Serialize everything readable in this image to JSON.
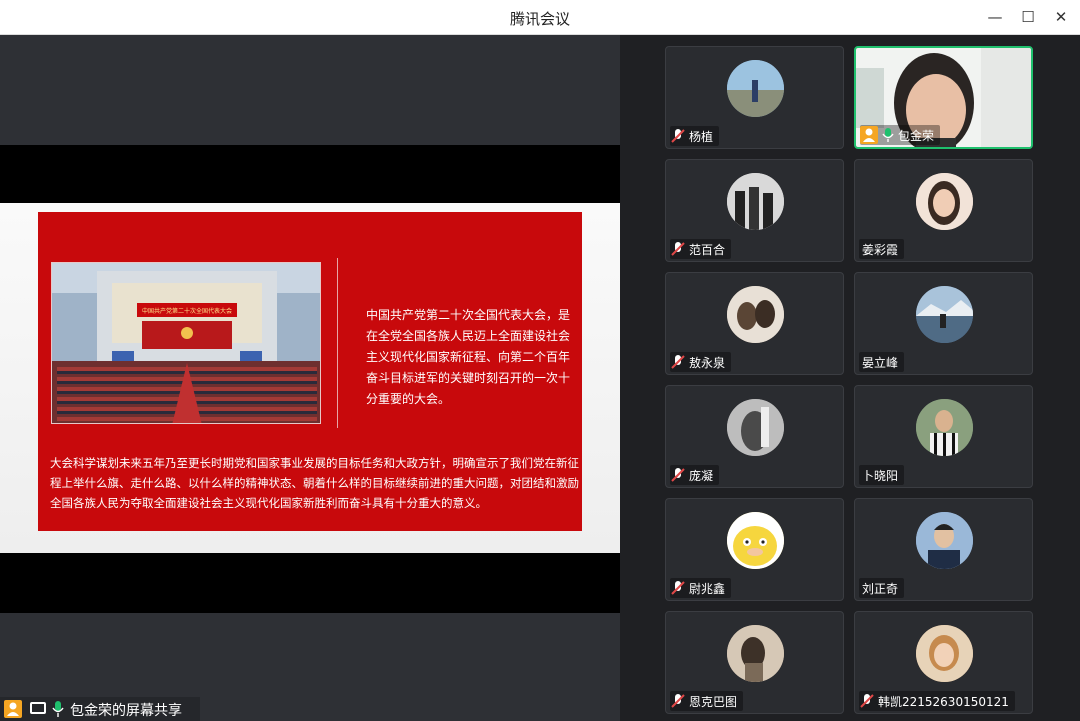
{
  "window": {
    "title": "腾讯会议",
    "minimize": "—",
    "maximize": "☐",
    "close": "✕"
  },
  "slide": {
    "right_text": "中国共产党第二十次全国代表大会，是在全党全国各族人民迈上全面建设社会主义现代化国家新征程、向第二个百年奋斗目标进军的关键时刻召开的一次十分重要的大会。",
    "bottom_text": "大会科学谋划未来五年乃至更长时期党和国家事业发展的目标任务和大政方针，明确宣示了我们党在新征程上举什么旗、走什么路、以什么样的精神状态、朝着什么样的目标继续前进的重大问题，对团结和激励全国各族人民为夺取全面建设社会主义现代化国家新胜利而奋斗具有十分重大的意义。",
    "banner_text": "中国共产党第二十次全国代表大会",
    "accent": "#c8090c"
  },
  "share_bar": {
    "text": "包金荣的屏幕共享"
  },
  "participants": [
    {
      "name": "杨植",
      "mic": "muted",
      "avatar_color": "#7aa6c9"
    },
    {
      "name": "包金荣",
      "mic": "on",
      "host": true,
      "video": true
    },
    {
      "name": "范百合",
      "mic": "muted",
      "avatar_color": "#cfcfcf"
    },
    {
      "name": "姜彩霞",
      "mic": "none",
      "avatar_color": "#d9b8a3"
    },
    {
      "name": "敖永泉",
      "mic": "muted",
      "avatar_color": "#c9b59a"
    },
    {
      "name": "晏立峰",
      "mic": "none",
      "avatar_color": "#5c7fa6"
    },
    {
      "name": "庞凝",
      "mic": "muted",
      "avatar_color": "#9a9a9a"
    },
    {
      "name": "卜晓阳",
      "mic": "none",
      "avatar_color": "#6b8a6b"
    },
    {
      "name": "尉兆鑫",
      "mic": "muted",
      "avatar_color": "#f6e15a"
    },
    {
      "name": "刘正奇",
      "mic": "none",
      "avatar_color": "#7a9cc4"
    },
    {
      "name": "恩克巴图",
      "mic": "muted",
      "avatar_color": "#b9a28a"
    },
    {
      "name": "韩凯22152630150121",
      "mic": "muted",
      "avatar_color": "#d1a46f"
    }
  ],
  "colors": {
    "host_badge": "#f5a623",
    "speaking_border": "#1fc06d",
    "muted_mic": "#e04848"
  }
}
